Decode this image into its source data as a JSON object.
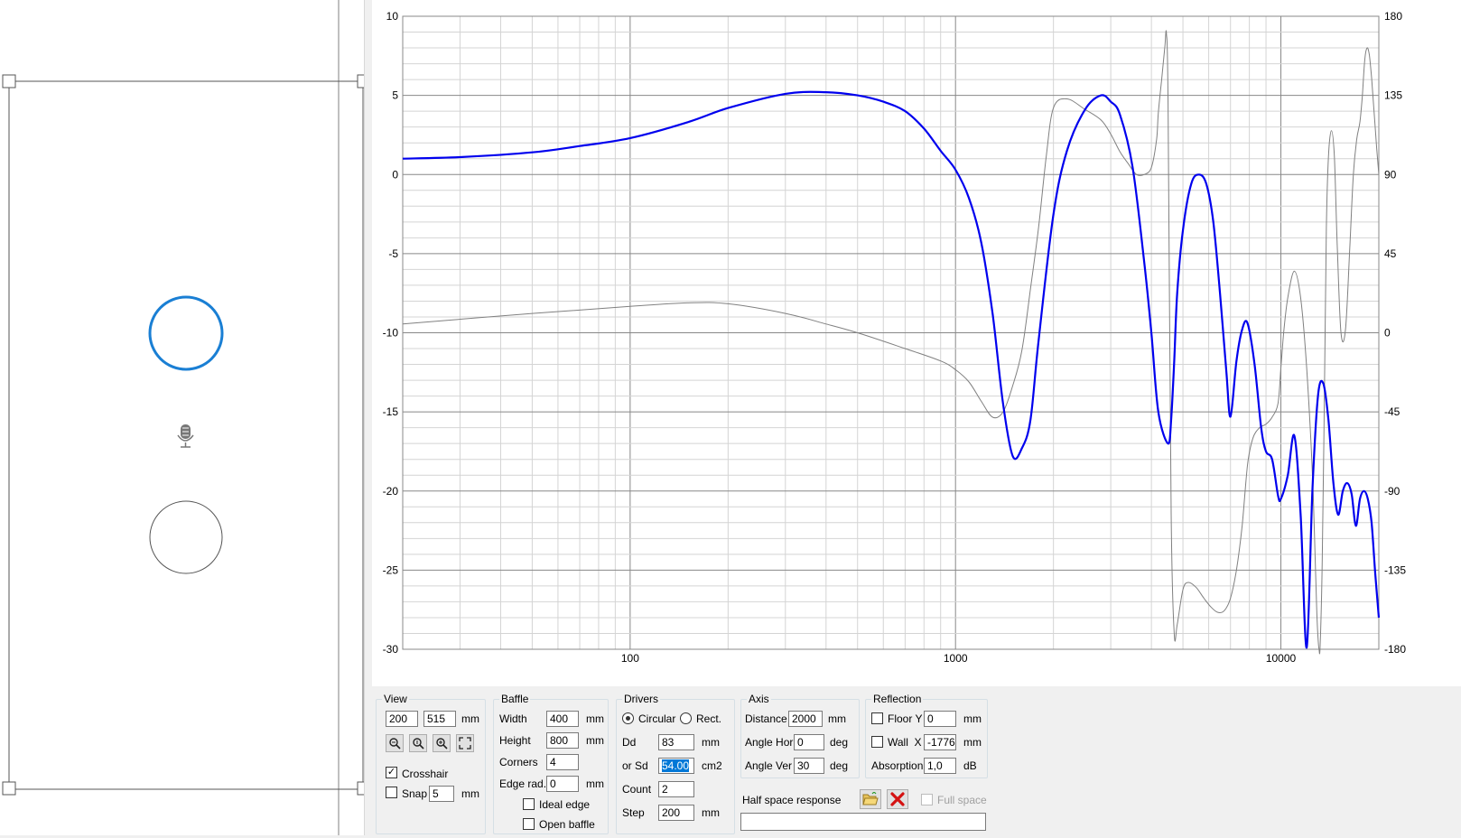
{
  "chart_data": {
    "type": "line",
    "x_scale": "log",
    "xlim": [
      20,
      20000
    ],
    "ylim": [
      -30,
      10
    ],
    "y2lim": [
      -180,
      180
    ],
    "grid": true,
    "x_tick_labels": [
      "100",
      "1000",
      "10000"
    ],
    "y_tick_labels": [
      "10",
      "5",
      "0",
      "-5",
      "-10",
      "-15",
      "-20",
      "-25",
      "-30"
    ],
    "y2_tick_labels": [
      "180",
      "135",
      "90",
      "45",
      "0",
      "-45",
      "-90",
      "-135",
      "-180"
    ],
    "series": [
      {
        "axis": "left",
        "color": "#0000ee",
        "x": [
          20,
          30,
          50,
          70,
          100,
          150,
          200,
          300,
          400,
          500,
          600,
          700,
          800,
          900,
          1000,
          1100,
          1200,
          1300,
          1400,
          1500,
          1600,
          1700,
          1800,
          2000,
          2200,
          2500,
          2800,
          3000,
          3200,
          3500,
          3800,
          4000,
          4200,
          4500,
          4600,
          4700,
          4800,
          5000,
          5300,
          5600,
          5900,
          6200,
          6500,
          6800,
          7000,
          7300,
          7600,
          7900,
          8300,
          8700,
          9000,
          9400,
          9800,
          10000,
          10500,
          11000,
          11500,
          12000,
          12500,
          13000,
          13500,
          14000,
          14500,
          15000,
          15500,
          16000,
          16500,
          17000,
          17500,
          18000,
          18500,
          19000,
          19500,
          20000
        ],
        "y": [
          1.0,
          1.1,
          1.4,
          1.8,
          2.3,
          3.3,
          4.2,
          5.1,
          5.2,
          5.0,
          4.6,
          4.0,
          2.9,
          1.5,
          0.3,
          -1.5,
          -4.3,
          -8.8,
          -14.5,
          -17.8,
          -17.3,
          -15.5,
          -10.5,
          -2.5,
          1.5,
          4.1,
          5.0,
          4.6,
          3.8,
          0.5,
          -5.5,
          -10.0,
          -15.0,
          -17.0,
          -15.5,
          -11.8,
          -7.5,
          -3.5,
          -0.6,
          0.0,
          -0.6,
          -3.0,
          -7.5,
          -12.5,
          -15.3,
          -11.8,
          -9.8,
          -9.4,
          -12.0,
          -16.0,
          -17.5,
          -18.0,
          -20.3,
          -20.5,
          -19.0,
          -16.5,
          -21.5,
          -29.9,
          -20.0,
          -14.0,
          -13.2,
          -15.5,
          -19.5,
          -21.5,
          -20.0,
          -19.5,
          -20.2,
          -22.2,
          -20.5,
          -20.0,
          -20.5,
          -22.0,
          -25.2,
          -28.0
        ]
      },
      {
        "axis": "right",
        "color": "#808080",
        "x": [
          20,
          50,
          100,
          150,
          200,
          300,
          400,
          500,
          700,
          900,
          1000,
          1100,
          1200,
          1300,
          1400,
          1500,
          1600,
          1700,
          1800,
          1900,
          2000,
          2200,
          2500,
          2800,
          3000,
          3200,
          3400,
          3600,
          3800,
          4000,
          4150,
          4200,
          4300,
          4400,
          4450,
          4500,
          4600,
          4700,
          4800,
          5000,
          5200,
          5500,
          5800,
          6100,
          6400,
          6700,
          7000,
          7300,
          7600,
          7900,
          8200,
          8600,
          9000,
          9400,
          9800,
          10000,
          10200,
          10500,
          11000,
          11500,
          12000,
          12500,
          12800,
          12900,
          13000,
          13100,
          13200,
          13400,
          13600,
          13800,
          14000,
          14300,
          14600,
          14900,
          15300,
          15800,
          16300,
          16700,
          17100,
          17500,
          17800,
          18100,
          18400,
          18700,
          19000,
          19300,
          19700,
          20000
        ],
        "y": [
          5,
          11,
          15,
          17,
          16.5,
          11,
          5,
          0,
          -9,
          -16,
          -21,
          -28,
          -39,
          -48,
          -45,
          -30,
          -10,
          25,
          60,
          100,
          128,
          133,
          127,
          121,
          113,
          103,
          96,
          90,
          90,
          94,
          110,
          125,
          144,
          163,
          170,
          130,
          -102,
          -171,
          -166,
          -146,
          -142,
          -145,
          -151,
          -156,
          -159,
          -158,
          -151,
          -135,
          -110,
          -75,
          -60,
          -54,
          -52,
          -48,
          -40,
          -20,
          0,
          20,
          35,
          20,
          -20,
          -80,
          -140,
          -160,
          -173,
          -180,
          -178,
          -130,
          -40,
          60,
          100,
          115,
          100,
          50,
          0,
          2,
          50,
          90,
          110,
          120,
          135,
          155,
          162,
          158,
          145,
          128,
          105,
          90
        ]
      }
    ]
  },
  "view": {
    "title": "View",
    "x": "200",
    "y": "515",
    "unit": "mm",
    "crosshair_label": "Crosshair",
    "crosshair_checked": true,
    "snap_label": "Snap",
    "snap_value": "5",
    "snap_unit": "mm"
  },
  "baffle": {
    "title": "Baffle",
    "width_label": "Width",
    "width": "400",
    "height_label": "Height",
    "height": "800",
    "corners_label": "Corners",
    "corners": "4",
    "edge_label": "Edge rad.",
    "edge": "0",
    "unit": "mm",
    "ideal_edge_label": "Ideal edge",
    "open_baffle_label": "Open baffle"
  },
  "drivers": {
    "title": "Drivers",
    "circular_label": "Circular",
    "rect_label": "Rect.",
    "dd_label": "Dd",
    "dd": "83",
    "dd_unit": "mm",
    "sd_label": "or Sd",
    "sd": "54.00",
    "sd_unit": "cm2",
    "count_label": "Count",
    "count": "2",
    "step_label": "Step",
    "step": "200",
    "step_unit": "mm"
  },
  "axis": {
    "title": "Axis",
    "distance_label": "Distance",
    "distance": "2000",
    "distance_unit": "mm",
    "angle_hor_label": "Angle Hor",
    "angle_hor": "0",
    "angle_ver_label": "Angle Ver",
    "angle_ver": "30",
    "deg": "deg"
  },
  "reflection": {
    "title": "Reflection",
    "floor_label": "Floor Y",
    "floor": "0",
    "wall_label": "Wall  X",
    "wall": "-1776",
    "unit": "mm",
    "absorption_label": "Absorption",
    "absorption": "1,0",
    "absorption_unit": "dB"
  },
  "half_space": {
    "label": "Half space response",
    "full_space_label": "Full space",
    "path_value": ""
  },
  "icons": {
    "microphone": "microphone-icon",
    "open_folder": "folder-open-icon",
    "delete": "red-x-icon",
    "zoom_out": "zoom-out-icon",
    "zoom_fit": "zoom-fit-icon",
    "zoom_in": "zoom-in-icon",
    "expand": "expand-icon"
  },
  "colors": {
    "selected_driver": "#1a7fd4",
    "response_curve": "#0000ee",
    "phase_curve": "#808080"
  }
}
